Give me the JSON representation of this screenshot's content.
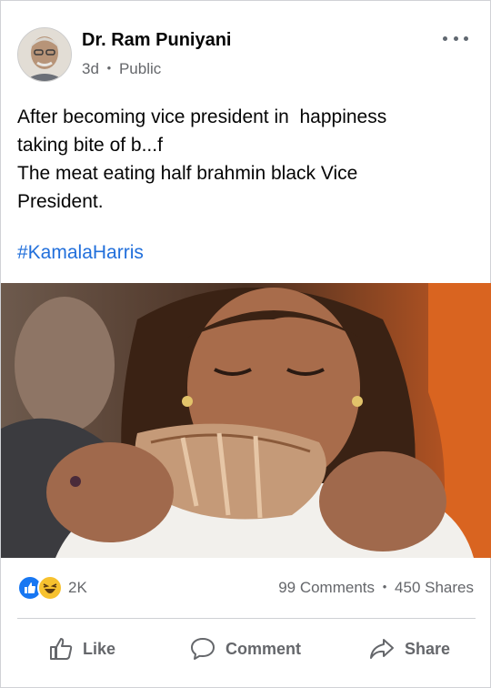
{
  "post": {
    "author": "Dr. Ram Puniyani",
    "time": "3d",
    "separator": "•",
    "audience": "Public",
    "text_lines": [
      "After becoming vice president in  happiness",
      "taking bite of b...f",
      "The meat eating half brahmin black Vice",
      "President."
    ],
    "hashtag": "#KamalaHarris"
  },
  "engagement": {
    "reactions": [
      "like",
      "haha"
    ],
    "reaction_count": "2K",
    "comments": "99 Comments",
    "dot": "•",
    "shares": "450 Shares"
  },
  "actions": {
    "like_label": "Like",
    "comment_label": "Comment",
    "share_label": "Share"
  },
  "icons": [
    "more-options-icon",
    "like-reaction-icon",
    "haha-reaction-icon",
    "thumbs-up-icon",
    "comment-bubble-icon",
    "share-arrow-icon"
  ],
  "colors": {
    "link": "#216fdb",
    "secondary_text": "#65676b",
    "like_blue": "#1877f2",
    "haha_yellow": "#f7c12e"
  }
}
